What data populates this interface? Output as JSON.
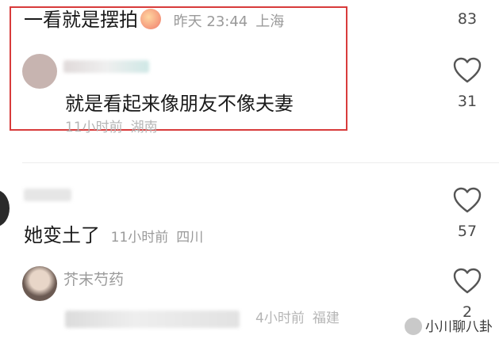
{
  "comments": [
    {
      "text": "一看就是摆拍",
      "date": "昨天 23:44",
      "location": "上海",
      "likes": "83"
    },
    {
      "text": "就是看起来像朋友不像夫妻",
      "time": "11小时前",
      "location": "湖南",
      "likes": "31"
    },
    {
      "text": "她变土了",
      "time": "11小时前",
      "location": "四川",
      "likes": "57"
    },
    {
      "username": "芥末芍药",
      "time": "4小时前",
      "location": "福建",
      "likes": "2"
    }
  ],
  "watermark": "小川聊八卦",
  "colors": {
    "highlight": "#d83b3b",
    "meta": "#9a9a9a"
  },
  "icons": [
    "heart-icon",
    "emoji-icon",
    "watermark-logo-icon"
  ]
}
